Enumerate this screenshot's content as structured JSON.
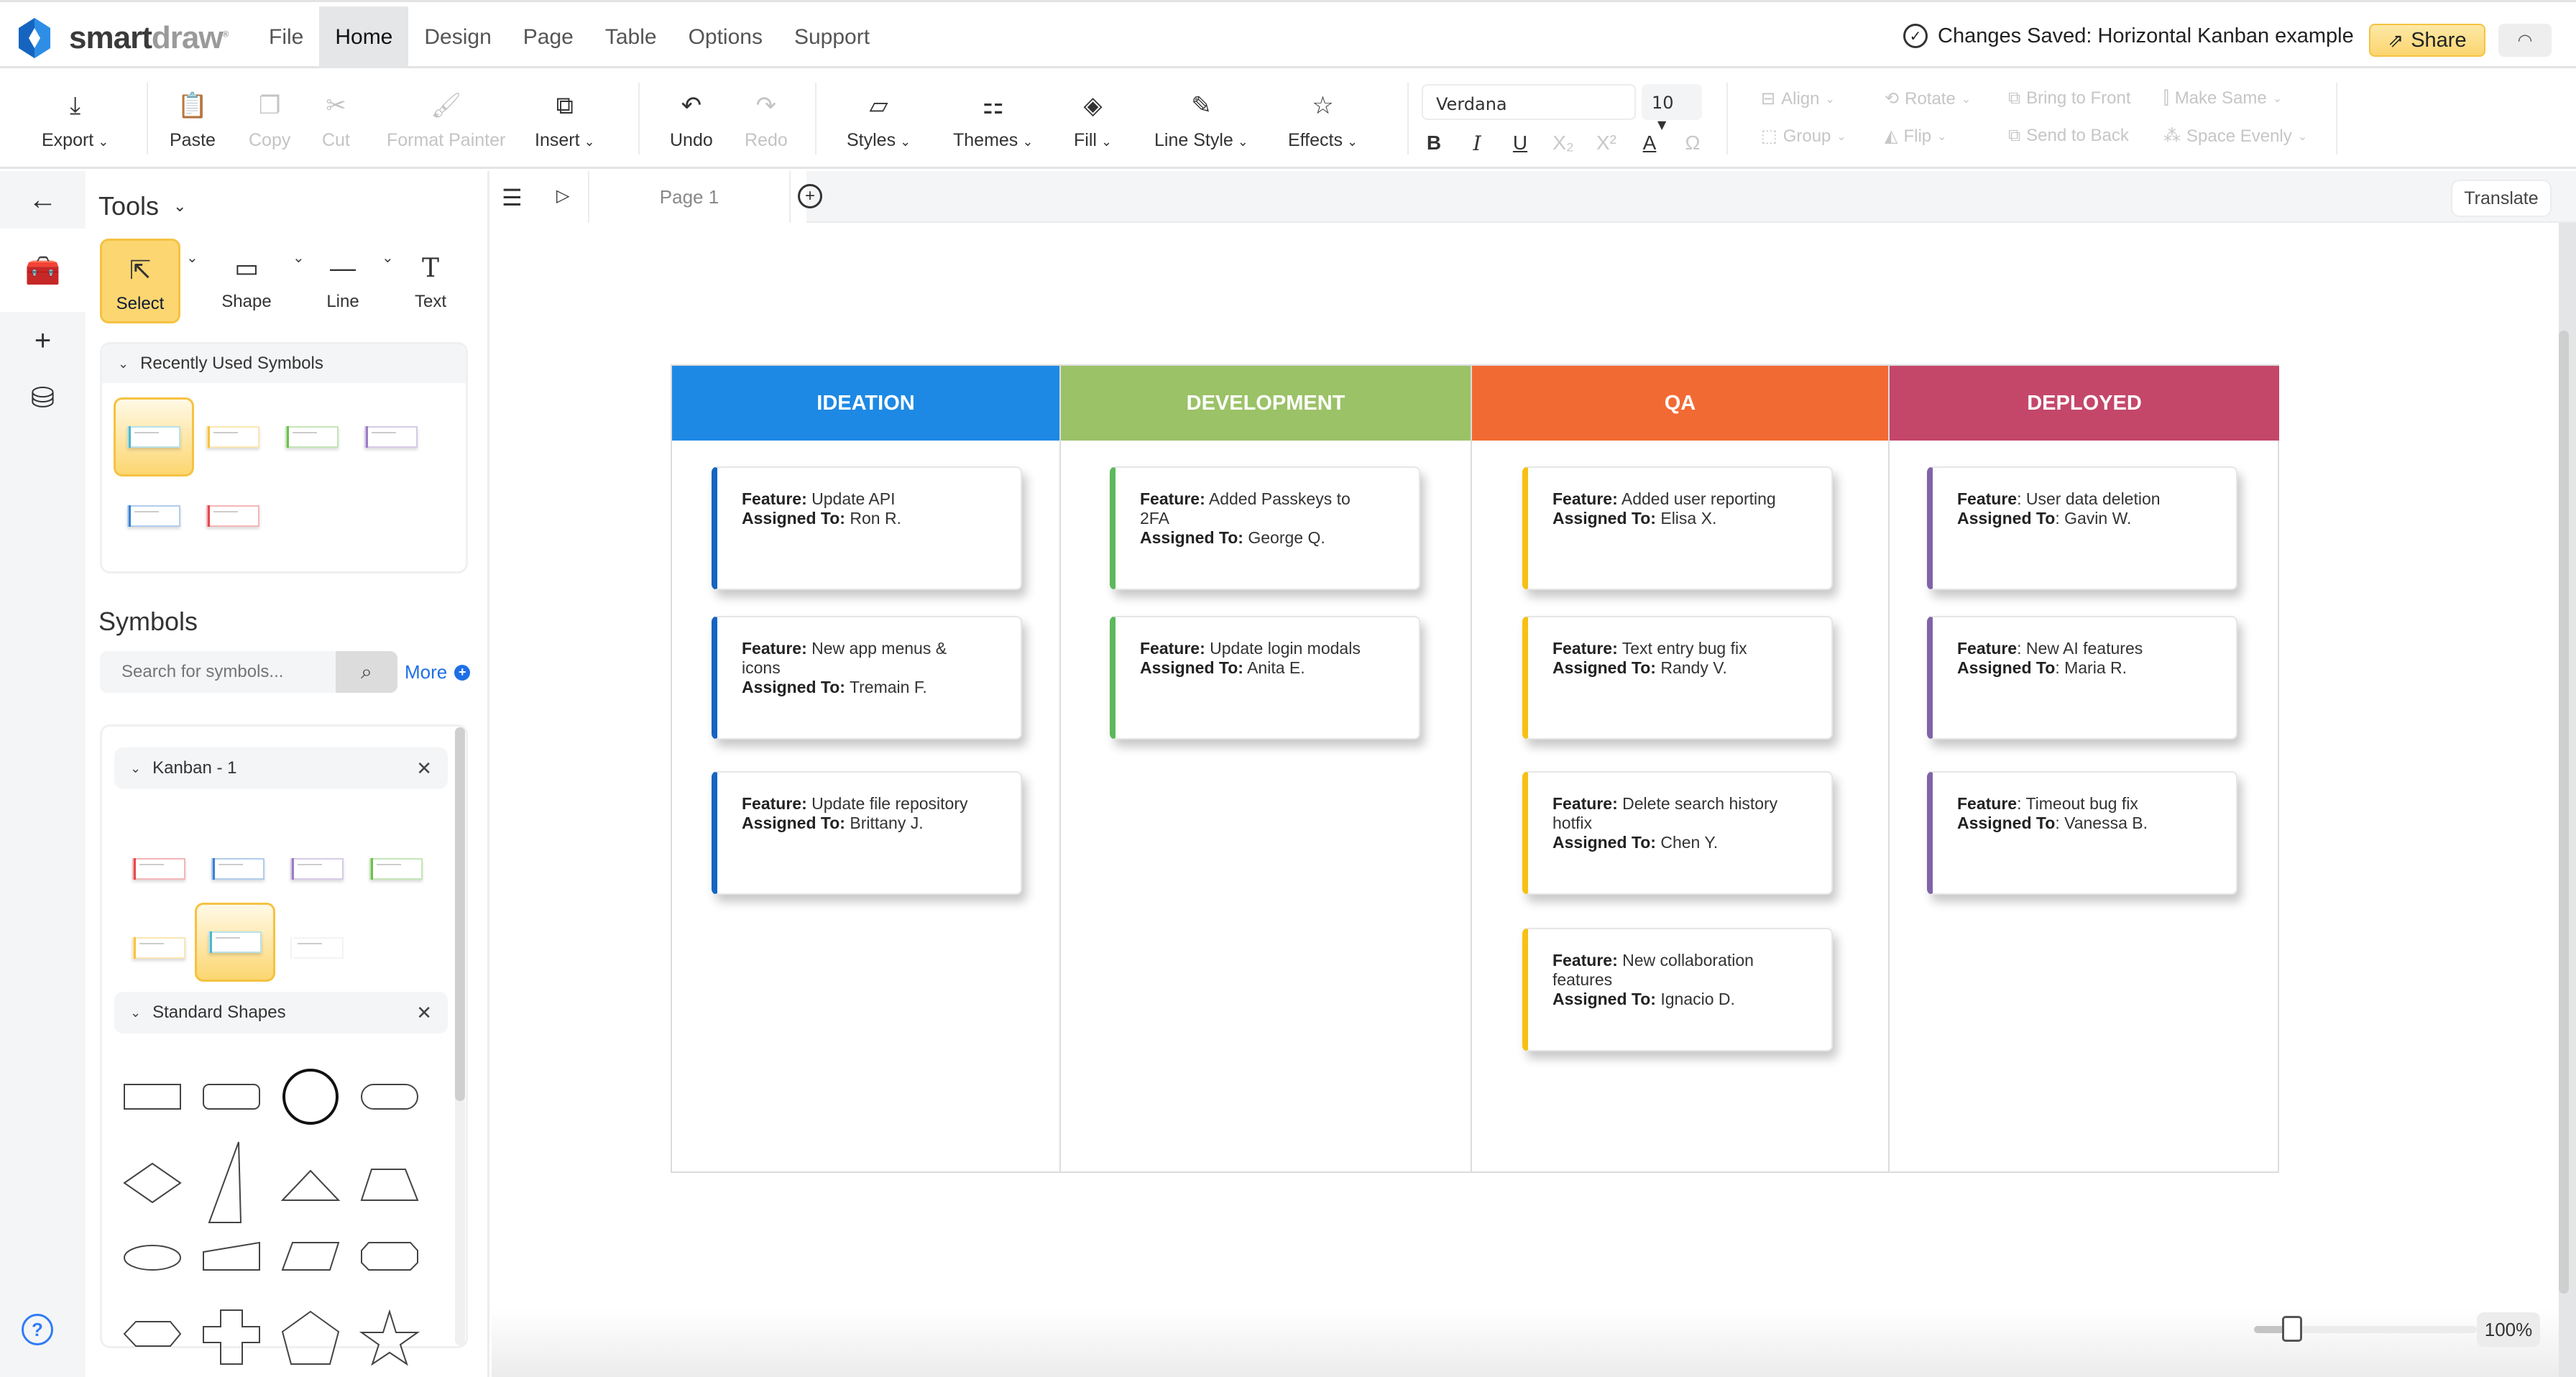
{
  "app": {
    "logo_smart": "smart",
    "logo_draw": "draw",
    "menu": [
      "File",
      "Home",
      "Design",
      "Page",
      "Table",
      "Options",
      "Support"
    ],
    "active_menu": "Home",
    "save_status": "Changes Saved: Horizontal Kanban example",
    "share_label": "Share"
  },
  "ribbon": {
    "export": "Export",
    "paste": "Paste",
    "copy": "Copy",
    "cut": "Cut",
    "format_painter": "Format Painter",
    "insert": "Insert",
    "undo": "Undo",
    "redo": "Redo",
    "styles": "Styles",
    "themes": "Themes",
    "fill": "Fill",
    "line_style": "Line Style",
    "effects": "Effects",
    "font_family": "Verdana",
    "font_size": "10",
    "align": "Align",
    "rotate": "Rotate",
    "bring_to_front": "Bring to Front",
    "make_same": "Make Same",
    "group": "Group",
    "flip": "Flip",
    "send_to_back": "Send to Back",
    "space_evenly": "Space Evenly"
  },
  "panel": {
    "title": "Tools",
    "tools": [
      "Select",
      "Shape",
      "Line",
      "Text"
    ],
    "recent_title": "Recently Used Symbols",
    "recent_colors": [
      "#4fb6c6",
      "#f5c242",
      "#6cc04a",
      "#9b7cc4",
      "#3b82d1",
      "#e5484d"
    ],
    "symbols_title": "Symbols",
    "search_placeholder": "Search for symbols...",
    "more_label": "More",
    "libraries": [
      {
        "name": "Kanban - 1",
        "colors": [
          "#e5484d",
          "#3b82d1",
          "#9b7cc4",
          "#6cc04a",
          "#f5c242",
          "#4fb6c6",
          "#ffffff"
        ]
      },
      {
        "name": "Standard Shapes"
      }
    ]
  },
  "canvas": {
    "page_tab": "Page 1",
    "translate_label": "Translate",
    "zoom_label": "100%",
    "zoom_fraction": 0.17
  },
  "board": {
    "columns": [
      {
        "title": "IDEATION",
        "header_color": "#1d89e4",
        "accent": "#1565c0",
        "cards": [
          {
            "feature": "Update API",
            "assignee": "Ron R."
          },
          {
            "feature": "New app menus & icons",
            "assignee": "Tremain F."
          },
          {
            "feature": "Update file repository",
            "assignee": "Brittany J."
          }
        ]
      },
      {
        "title": "DEVELOPMENT",
        "header_color": "#9bc267",
        "accent": "#5cb85c",
        "cards": [
          {
            "feature": "Added Passkeys to 2FA",
            "assignee": "George Q."
          },
          {
            "feature": "Update login modals",
            "assignee": "Anita E."
          }
        ]
      },
      {
        "title": "QA",
        "header_color": "#f26a33",
        "accent": "#f7c013",
        "cards": [
          {
            "feature": "Added user reporting",
            "assignee": "Elisa X."
          },
          {
            "feature": "Text entry bug fix",
            "assignee": "Randy V."
          },
          {
            "feature": "Delete search history hotfix",
            "assignee": "Chen Y."
          },
          {
            "feature": "New collaboration features",
            "assignee": "Ignacio D."
          }
        ]
      },
      {
        "title": "DEPLOYED",
        "header_color": "#c4476a",
        "accent": "#8063a8",
        "cards": [
          {
            "feature": "User data deletion",
            "assignee": "Gavin W."
          },
          {
            "feature": "New AI features",
            "assignee": "Maria R."
          },
          {
            "feature": "Timeout bug fix",
            "assignee": "Vanessa B."
          }
        ]
      }
    ],
    "feature_label": "Feature",
    "assigned_label": "Assigned To"
  }
}
